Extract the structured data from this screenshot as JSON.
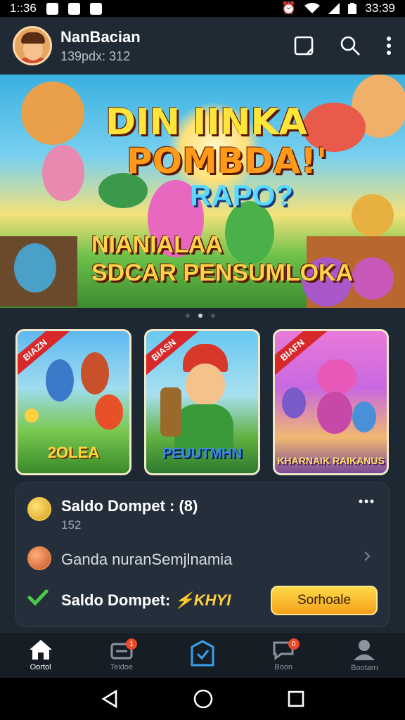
{
  "status": {
    "time": "1::36",
    "clock": "33:39"
  },
  "header": {
    "user_name": "NanBacian",
    "user_sub": "139pdx: 312"
  },
  "banner": {
    "line1": "DIN IINKA",
    "line2": "POMBDA!'",
    "line3": "RAPO?",
    "line4a": "NIANIALAA",
    "line4b": "SDCAR PENSUMLOKA",
    "page_count": 3,
    "active_page": 2
  },
  "games": [
    {
      "ribbon": "BIAZN",
      "title": "2OLEA"
    },
    {
      "ribbon": "BIASN",
      "title": "PEUUTMHN"
    },
    {
      "ribbon": "BIAFN",
      "title": "KHARNAIK RAIKANUS"
    }
  ],
  "wallet": {
    "row1_label": "Saldo Dompet : (8)",
    "row1_value": "152",
    "row2_label": "Ganda nuranSemjlnamia",
    "row3_label": "Saldo Dompet:",
    "row3_value": "⚡KHYI",
    "button_label": "Sorhoale"
  },
  "nav": [
    {
      "label": "Oortol",
      "badge": ""
    },
    {
      "label": "Teidoe",
      "badge": "1"
    },
    {
      "label": "",
      "badge": ""
    },
    {
      "label": "Boon",
      "badge": "0"
    },
    {
      "label": "Bootarn",
      "badge": ""
    }
  ],
  "colors": {
    "accent": "#f5a21a",
    "background": "#1e2833",
    "card": "#252f3b",
    "active_icon": "#3aa0e8"
  }
}
